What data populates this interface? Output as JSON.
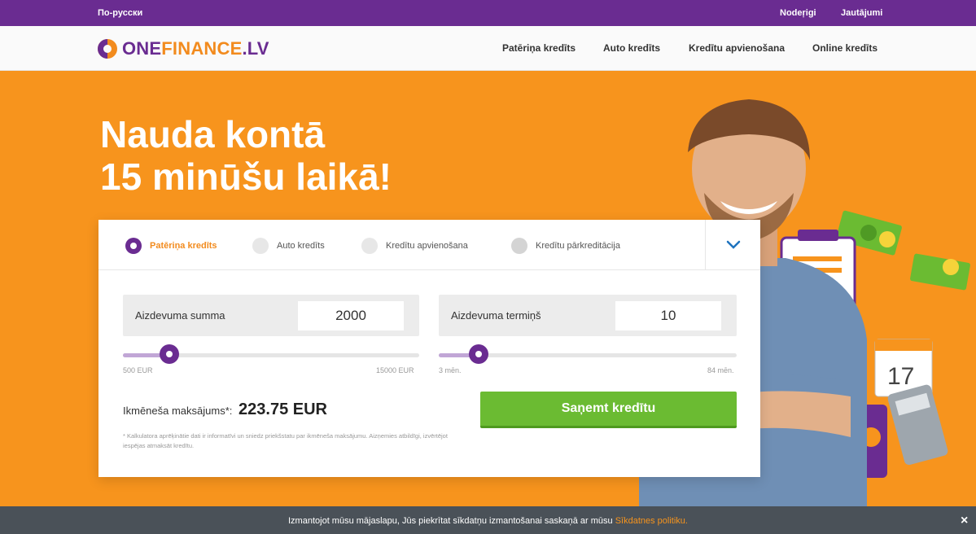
{
  "topbar": {
    "language_link": "По-русски",
    "register": "Nodeŗigi",
    "faq": "Jautājumi"
  },
  "brand": {
    "one": "ONE",
    "finance": "FINANCE",
    "tld": ".LV"
  },
  "nav": {
    "items": [
      "Patēriņa kredīts",
      "Auto kredīts",
      "Kredītu apvienošana",
      "Online kredīts"
    ]
  },
  "hero": {
    "line1": "Nauda kontā",
    "line2": "15 minūšu laikā!"
  },
  "calculator": {
    "tabs": [
      "Patēriņa kredīts",
      "Auto kredīts",
      "Kredītu apvienošana",
      "Kredītu pārkreditācija"
    ],
    "active_tab": 0,
    "amount": {
      "label": "Aizdevuma summa",
      "value": "2000",
      "min_label": "500 EUR",
      "max_label": "15000 EUR",
      "position": 0.107
    },
    "term": {
      "label": "Aizdevuma termiņš",
      "value": "10",
      "min_label": "3 mēn.",
      "max_label": "84 mēn.",
      "position": 0.086
    },
    "monthly_label": "Ikmēneša maksājums*:",
    "monthly_value": "223.75 EUR",
    "submit_label": "Saņemt kredītu",
    "note": "* Kalkulatora aprēķinātie dati ir informatīvi un sniedz priekšstatu par ikmēneša maksājumu. Aizņemies atbildīgi, izvērtējot iespējas atmaksāt kredītu."
  },
  "cookie": {
    "text": "Izmantojot mūsu mājaslapu, Jūs piekrītat sīkdatņu izmantošanai saskaņā ar mūsu ",
    "link": "Sīkdatnes politiku.",
    "close": "×"
  },
  "colors": {
    "purple": "#6a2c91",
    "orange": "#f7941d",
    "green": "#6bbb32",
    "cookie_bg": "#4a5158"
  }
}
